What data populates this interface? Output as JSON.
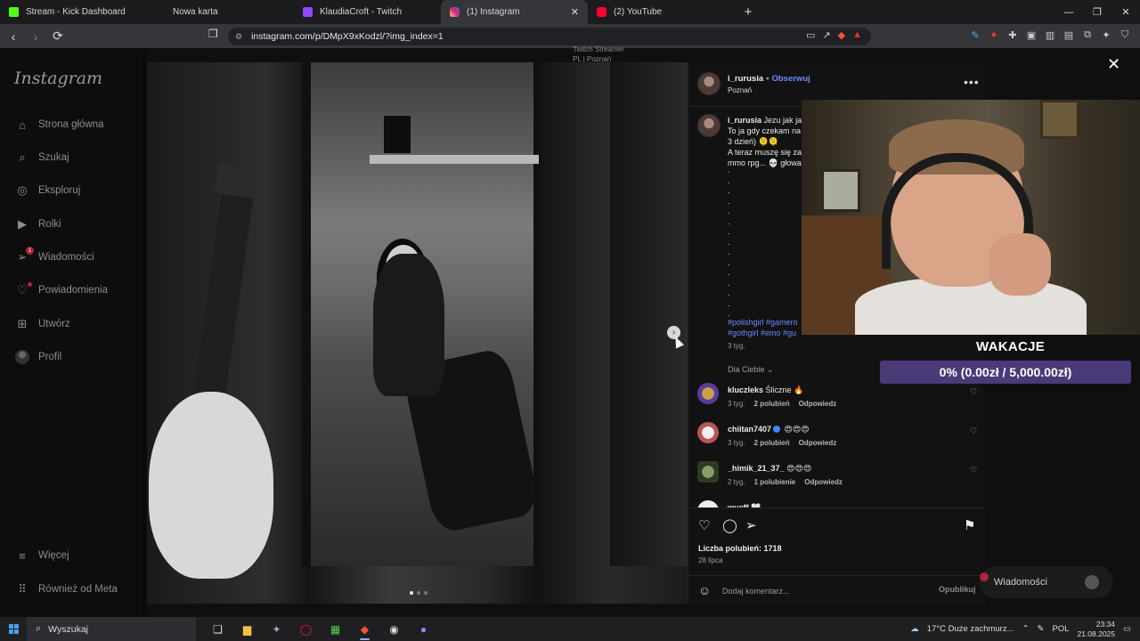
{
  "browser": {
    "tabs": [
      {
        "title": "Stream - Kick Dashboard",
        "favicon_color": "#53fc18",
        "active": false
      },
      {
        "title": "Nowa karta",
        "favicon_color": "#1c1c1f",
        "active": false
      },
      {
        "title": "KlaudiaCroft - Twitch",
        "favicon_color": "#9146ff",
        "active": false
      },
      {
        "title": "(1) Instagram",
        "favicon_color": "#d62976",
        "active": true
      },
      {
        "title": "(2) YouTube",
        "favicon_color": "#ff0033",
        "active": false
      }
    ],
    "url": "instagram.com/p/DMpX9xKodzl/?img_index=1"
  },
  "instagram": {
    "logo": "Instagram",
    "nav": {
      "home": "Strona główna",
      "search": "Szukaj",
      "explore": "Eksploruj",
      "reels": "Rolki",
      "messages": "Wiadomości",
      "messages_badge": "1",
      "notifications": "Powiadomienia",
      "create": "Utwórz",
      "profile": "Profil",
      "more": "Więcej",
      "meta": "Również od Meta"
    },
    "post": {
      "username": "i_rurusia",
      "follow": "Obserwuj",
      "location": "Poznań",
      "caption_user": "i_rurusia",
      "caption_lines": [
        "Jezu jak ja",
        "To ja gdy czekam na",
        "3 dzień) 🫠🫠",
        "A teraz muszę się za",
        "mmo rpg... 💀 głowa"
      ],
      "caption_dots": [
        ".",
        ".",
        ".",
        ".",
        ".",
        ".",
        ".",
        ".",
        ".",
        ".",
        ".",
        ".",
        ".",
        ".",
        "."
      ],
      "hashtags_line1": "#polishgirl #gamero",
      "hashtags_line2": "#gothgirl #emo #gu",
      "caption_time": "3 tyg.",
      "for_you": "Dla Ciebie",
      "likes": "Liczba polubień: 1718",
      "date": "28 lipca",
      "comment_placeholder": "Dodaj komentarz...",
      "publish": "Opublikuj",
      "reply": "Odpowiedz"
    },
    "comments": [
      {
        "user": "kluczleks",
        "text": "Śliczne 🔥",
        "time": "3 tyg.",
        "likes": "2 polubień",
        "verified": false
      },
      {
        "user": "chiitan7407",
        "text": "😍😍😍",
        "time": "3 tyg.",
        "likes": "2 polubień",
        "verified": true
      },
      {
        "user": "_himik_21_37_",
        "text": "😍😍😍",
        "time": "2 tyg.",
        "likes": "1 polubienie",
        "verified": false
      },
      {
        "user": "wueff",
        "text": "🤍",
        "time": "",
        "likes": "",
        "verified": false
      }
    ],
    "background_text": [
      "Twitch Streamer",
      "PL | Poznań"
    ]
  },
  "stream": {
    "goal_title": "WAKACJE",
    "goal_text": "0% (0.00zł / 5,000.00zł)",
    "goal_progress": 0,
    "messages_pill": "Wiadomości"
  },
  "taskbar": {
    "search": "Wyszukaj",
    "weather": "17°C  Duże zachmurz...",
    "lang": "POL",
    "time": "23:34",
    "date": "21.08.2025"
  },
  "colors": {
    "accent_link": "#6a8cff",
    "goal_bar": "#4a3a78",
    "badge": "#b0233b"
  }
}
